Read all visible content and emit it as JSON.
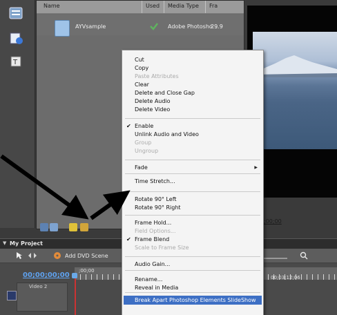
{
  "project_panel": {
    "columns": {
      "name": "Name",
      "used": "Used",
      "media_type": "Media Type",
      "frame_rate": "Fra"
    },
    "rows": [
      {
        "name": "AYVsample",
        "media_type": "Adobe Photosho...",
        "frame_rate": "29.9"
      }
    ]
  },
  "preview": {
    "time": ";00;00"
  },
  "timeline": {
    "panel_title": "My Project",
    "add_dvd_scene": "Add DVD Scene",
    "timecode": "00;00;00;00",
    "ruler_start": ";00;00",
    "ruler_end": "00;03;12;06",
    "track_name": "Video 2"
  },
  "context_menu": {
    "items": [
      {
        "label": "Cut",
        "enabled": true
      },
      {
        "label": "Copy",
        "enabled": true
      },
      {
        "label": "Paste Attributes",
        "enabled": false
      },
      {
        "label": "Clear",
        "enabled": true
      },
      {
        "label": "Delete and Close Gap",
        "enabled": true
      },
      {
        "label": "Delete Audio",
        "enabled": true
      },
      {
        "label": "Delete Video",
        "enabled": true
      },
      {
        "label": "Enable",
        "enabled": true,
        "checked": true
      },
      {
        "label": "Unlink Audio and Video",
        "enabled": true
      },
      {
        "label": "Group",
        "enabled": false
      },
      {
        "label": "Ungroup",
        "enabled": false
      },
      {
        "label": "Fade",
        "enabled": true,
        "submenu": true
      },
      {
        "label": "Time Stretch...",
        "enabled": true
      },
      {
        "label": "Rotate 90° Left",
        "enabled": true
      },
      {
        "label": "Rotate 90° Right",
        "enabled": true
      },
      {
        "label": "Frame Hold...",
        "enabled": true
      },
      {
        "label": "Field Options...",
        "enabled": false
      },
      {
        "label": "Frame Blend",
        "enabled": true,
        "checked": true
      },
      {
        "label": "Scale to Frame Size",
        "enabled": false
      },
      {
        "label": "Audio Gain...",
        "enabled": true
      },
      {
        "label": "Rename...",
        "enabled": true
      },
      {
        "label": "Reveal in Media",
        "enabled": true
      },
      {
        "label": "Break Apart Photoshop Elements SlideShow",
        "enabled": true,
        "highlighted": true
      }
    ]
  },
  "colors": {
    "menu_highlight": "#3d6fc4",
    "timecode": "#5fa2ef",
    "used_check": "#5fb35f",
    "annotation_arrow": "#000000"
  },
  "icons": [
    "menu-icon",
    "new-item-icon",
    "title-icon",
    "photoshop-file-icon",
    "used-check-icon",
    "selection-tool-icon",
    "add-dvd-scene-icon",
    "zoom-icon",
    "folder-icon"
  ]
}
